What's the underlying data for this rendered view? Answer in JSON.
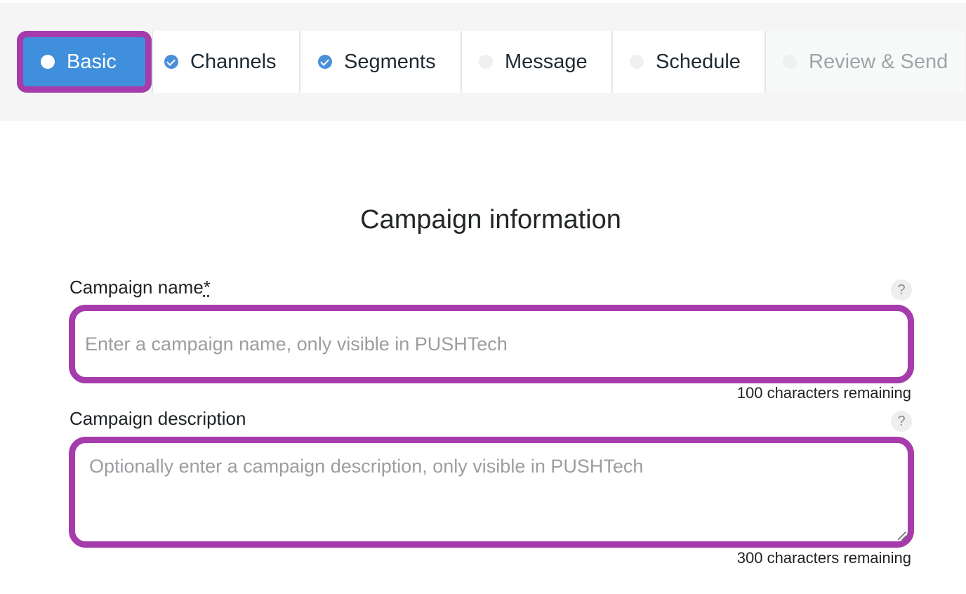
{
  "stepper": {
    "steps": [
      {
        "label": "Basic",
        "state": "active"
      },
      {
        "label": "Channels",
        "state": "done"
      },
      {
        "label": "Segments",
        "state": "done"
      },
      {
        "label": "Message",
        "state": "pending"
      },
      {
        "label": "Schedule",
        "state": "pending"
      },
      {
        "label": "Review & Send",
        "state": "disabled"
      }
    ]
  },
  "form": {
    "title": "Campaign information",
    "name": {
      "label": "Campaign name",
      "required_marker": "*",
      "placeholder": "Enter a campaign name, only visible in PUSHTech",
      "value": "",
      "help": "?",
      "counter": "100 characters remaining"
    },
    "description": {
      "label": "Campaign description",
      "placeholder": "Optionally enter a campaign description, only visible in PUSHTech",
      "value": "",
      "help": "?",
      "counter": "300 characters remaining"
    }
  },
  "colors": {
    "active_step": "#3f8fdc",
    "highlight": "#a63cab",
    "done_check": "#4a90d9",
    "bar_background": "#f4f5f4"
  },
  "icons": {
    "step_active": "dot-icon",
    "step_done": "check-circle-icon",
    "step_pending": "empty-dot-icon",
    "help": "question-mark-icon"
  }
}
